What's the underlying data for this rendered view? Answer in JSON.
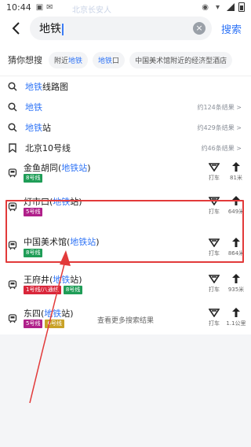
{
  "status": {
    "time": "10:44"
  },
  "map_hint": "北京长安人",
  "search": {
    "query": "地铁",
    "submit_label": "搜索"
  },
  "guess": {
    "label": "猜你想搜",
    "chips": [
      {
        "pre": "附近",
        "hl": "地铁",
        "post": ""
      },
      {
        "pre": "",
        "hl": "地铁",
        "post": "口"
      },
      {
        "pre": "中国美术馆附近的经济型酒店",
        "hl": "",
        "post": ""
      }
    ]
  },
  "suggestions": [
    {
      "icon": "search-icon",
      "hl": "地铁",
      "post": "线路图",
      "meta": ""
    },
    {
      "icon": "search-icon",
      "hl": "地铁",
      "post": "",
      "meta": "约124条结果 >"
    },
    {
      "icon": "search-icon",
      "hl": "地铁",
      "post": "站",
      "meta": "约429条结果 >"
    },
    {
      "icon": "bookmark-icon",
      "pre": "北京10号线",
      "hl": "",
      "post": "",
      "meta": "约46条结果 >"
    }
  ],
  "stations": [
    {
      "pre": "金鱼胡同(",
      "hl": "地铁站",
      "post": ")",
      "lines": [
        {
          "name": "8号线",
          "color": "#1f9d57"
        }
      ],
      "taxi": "打车",
      "distance": "81米"
    },
    {
      "pre": "灯市口(",
      "hl": "地铁",
      "post": "站)",
      "lines": [
        {
          "name": "5号线",
          "color": "#b0208a"
        }
      ],
      "taxi": "打车",
      "distance": "649米"
    },
    {
      "pre": "中国美术馆(",
      "hl": "地铁站",
      "post": ")",
      "lines": [
        {
          "name": "8号线",
          "color": "#1f9d57"
        }
      ],
      "taxi": "打车",
      "distance": "864米"
    },
    {
      "pre": "王府井(",
      "hl": "地铁",
      "post": "站)",
      "lines": [
        {
          "name": "1号线/八通线",
          "color": "#d9263a"
        },
        {
          "name": "8号线",
          "color": "#1f9d57"
        }
      ],
      "taxi": "打车",
      "distance": "935米"
    },
    {
      "pre": "东四(",
      "hl": "地铁",
      "post": "站)",
      "lines": [
        {
          "name": "5号线",
          "color": "#b0208a"
        },
        {
          "name": "6号线",
          "color": "#c9a227"
        }
      ],
      "taxi": "打车",
      "distance": "1.1公里"
    }
  ],
  "more_label": "查看更多搜索结果",
  "colors": {
    "accent": "#2f74f6",
    "annotation": "#e23a3a"
  }
}
